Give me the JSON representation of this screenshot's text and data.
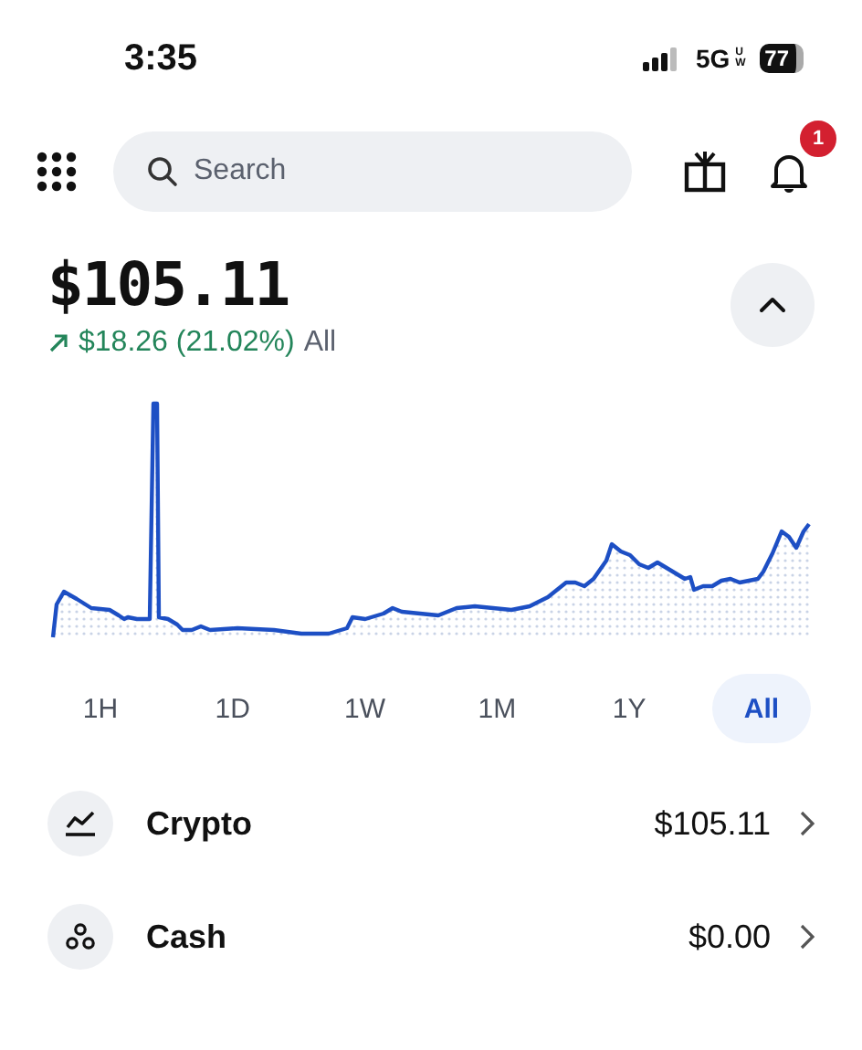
{
  "status_bar": {
    "time": "3:35",
    "network": "5G",
    "network_suffix": "UW",
    "battery": "77"
  },
  "header": {
    "search": {
      "placeholder": "Search"
    },
    "notification_count": "1"
  },
  "balance": {
    "amount": "$105.11",
    "change": "$18.26 (21.02%)",
    "change_period": "All",
    "rising": true,
    "expanded": true
  },
  "time_ranges": [
    {
      "label": "1H",
      "selected": false
    },
    {
      "label": "1D",
      "selected": false
    },
    {
      "label": "1W",
      "selected": false
    },
    {
      "label": "1M",
      "selected": false
    },
    {
      "label": "1Y",
      "selected": false
    },
    {
      "label": "All",
      "selected": true
    }
  ],
  "assets": [
    {
      "kind": "crypto",
      "name": "Crypto",
      "value": "$105.11"
    },
    {
      "kind": "cash",
      "name": "Cash",
      "value": "$0.00"
    }
  ]
}
